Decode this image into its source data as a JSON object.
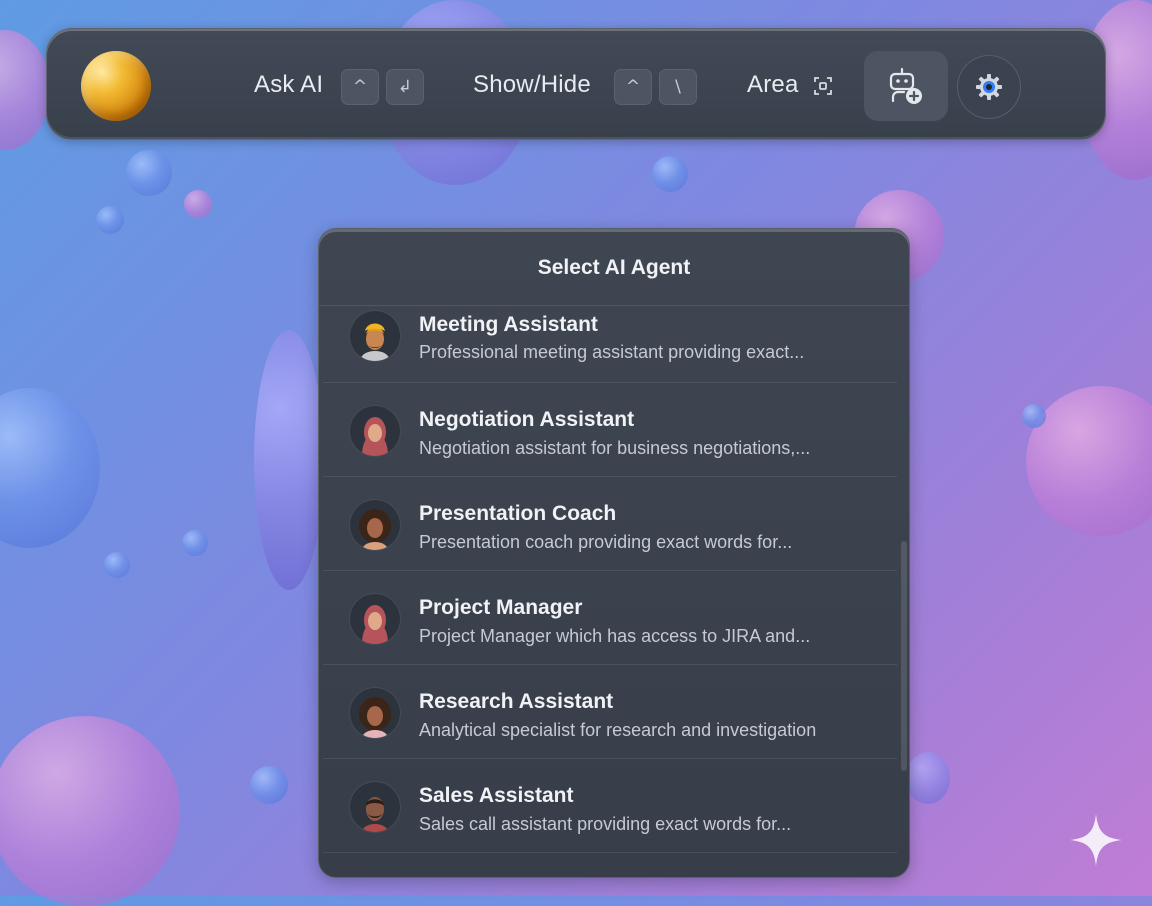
{
  "toolbar": {
    "ask_ai_label": "Ask AI",
    "ask_ai_keys": [
      "^",
      "↲"
    ],
    "show_hide_label": "Show/Hide",
    "show_hide_keys": [
      "^",
      "\\"
    ],
    "area_label": "Area"
  },
  "agent_panel": {
    "title": "Select AI Agent",
    "agents": [
      {
        "name": "Meeting Assistant",
        "description": "Professional meeting assistant providing exact..."
      },
      {
        "name": "Negotiation Assistant",
        "description": "Negotiation assistant for business negotiations,..."
      },
      {
        "name": "Presentation Coach",
        "description": "Presentation coach providing exact words for..."
      },
      {
        "name": "Project Manager",
        "description": "Project Manager which has access to JIRA and..."
      },
      {
        "name": "Research Assistant",
        "description": "Analytical specialist for research and investigation"
      },
      {
        "name": "Sales Assistant",
        "description": "Sales call assistant providing exact words for..."
      }
    ]
  },
  "colors": {
    "accent": "#2f7df6",
    "panel_bg": "#3b424e",
    "text_primary": "#f0f2f5",
    "text_secondary": "#c5cad3"
  }
}
